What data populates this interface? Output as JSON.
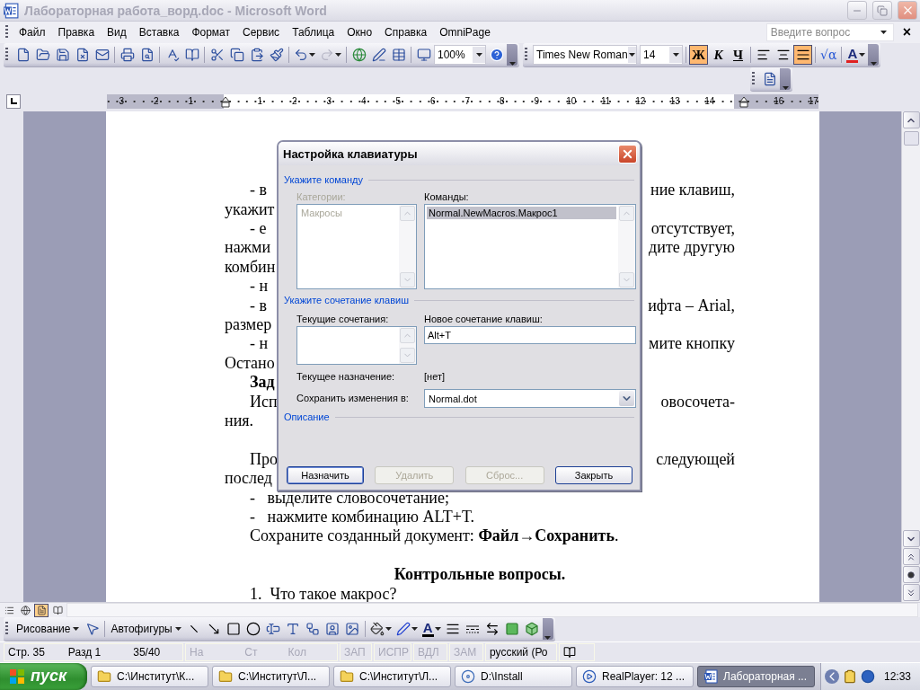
{
  "window": {
    "title": "Лабораторная работа_ворд.doc - Microsoft Word",
    "active": false
  },
  "menu": [
    "Файл",
    "Правка",
    "Вид",
    "Вставка",
    "Формат",
    "Сервис",
    "Таблица",
    "Окно",
    "Справка",
    "OmniPage"
  ],
  "help_field": {
    "placeholder": "Введите вопрос",
    "close": "×"
  },
  "standard_toolbar": {
    "zoom": "100%",
    "redo_disabled": true
  },
  "formatting_toolbar": {
    "font": "Times New Roman",
    "size": "14",
    "styles": [
      {
        "label": "Ж",
        "selected": true
      },
      {
        "label": "К",
        "selected": false
      },
      {
        "label": "Ч",
        "selected": false
      }
    ],
    "alignments": [
      {
        "selected": false
      },
      {
        "selected": false
      },
      {
        "selected": true
      }
    ],
    "equation": "√α",
    "font_color": "A"
  },
  "ruler": {
    "left_marks": [
      "3",
      "2",
      "1"
    ],
    "marks": [
      "1",
      "2",
      "3",
      "4",
      "5",
      "6",
      "7",
      "8",
      "9",
      "10",
      "11",
      "12",
      "13",
      "14"
    ],
    "end_marks": [
      "16",
      "17"
    ]
  },
  "document": {
    "rows": [
      {
        "kind": "line",
        "indent": true,
        "left": "- в",
        "right": "ние клавиш,",
        "gap_before": false
      },
      {
        "kind": "line",
        "indent": false,
        "left": "укажит",
        "gap_before": false
      },
      {
        "kind": "line",
        "indent": true,
        "left": "- е",
        "right": "отсутствует,",
        "gap_before": false
      },
      {
        "kind": "line",
        "indent": false,
        "left": "нажми",
        "right": "дите другую",
        "gap_before": false
      },
      {
        "kind": "line",
        "indent": false,
        "left": "комбин",
        "gap_before": false
      },
      {
        "kind": "line",
        "indent": true,
        "left": "- н",
        "gap_before": false
      },
      {
        "kind": "line",
        "indent": true,
        "left": "- в",
        "right": "ифта – Arial,",
        "gap_before": false
      },
      {
        "kind": "line",
        "indent": false,
        "left": "размер",
        "gap_before": false
      },
      {
        "kind": "line",
        "indent": true,
        "left": "- н",
        "right": "мите кнопку",
        "gap_before": false
      },
      {
        "kind": "line",
        "indent": false,
        "left": "Остано",
        "gap_before": false
      },
      {
        "kind": "bold",
        "indent": true,
        "left": "Зад",
        "gap_before": false
      },
      {
        "kind": "line",
        "indent": true,
        "left": "Исп",
        "right": "овосочета-",
        "gap_before": false
      },
      {
        "kind": "line",
        "indent": false,
        "left": "ния.",
        "gap_before": false
      },
      {
        "kind": "line",
        "indent": true,
        "left": "Про",
        "right": "следующей",
        "gap_before": true
      },
      {
        "kind": "line",
        "indent": false,
        "left": "послед",
        "gap_before": false
      },
      {
        "kind": "line",
        "indent": true,
        "left": "-   выделите словосочетание;",
        "gap_before": false
      },
      {
        "kind": "line",
        "indent": true,
        "left": "-   нажмите комбинацию ALT+T.",
        "gap_before": false
      },
      {
        "kind": "line",
        "indent": true,
        "left": "Сохраните созданный документ: **Файл→Сохранить**.",
        "gap_before": false
      },
      {
        "kind": "heading",
        "indent": false,
        "left": "Контрольные вопросы.",
        "gap_before": true
      },
      {
        "kind": "line",
        "indent": true,
        "left": "1.  Что такое макрос?",
        "gap_before": false
      }
    ]
  },
  "dialog": {
    "title": "Настройка клавиатуры",
    "command_group": "Укажите команду",
    "categories": {
      "label": "Категории:",
      "disabled": true,
      "items": [
        {
          "text": "Макросы",
          "selected": false
        }
      ]
    },
    "commands": {
      "label": "Команды:",
      "disabled": false,
      "items": [
        {
          "text": "Normal.NewMacros.Макрос1",
          "selected": true
        }
      ]
    },
    "keys_group": "Укажите сочетание клавиш",
    "current_keys": {
      "label": "Текущие сочетания:"
    },
    "new_keys": {
      "label": "Новое сочетание клавиш:",
      "value": "Alt+T"
    },
    "assignment": {
      "label": "Текущее назначение:",
      "value": "[нет]"
    },
    "save_in": {
      "label": "Сохранить изменения в:",
      "value": "Normal.dot"
    },
    "description_group": "Описание",
    "buttons": [
      {
        "label": "Назначить",
        "default": true,
        "disabled": false
      },
      {
        "label": "Удалить",
        "default": false,
        "disabled": true
      },
      {
        "label": "Сброс...",
        "default": false,
        "disabled": true
      },
      {
        "label": "Закрыть",
        "default": false,
        "disabled": false
      }
    ]
  },
  "drawing_toolbar": {
    "draw_menu": "Рисование",
    "autoshapes": "Автофигуры",
    "font_color": "A"
  },
  "status_bar": {
    "panels": [
      {
        "items": [
          {
            "text": "Стр. 35",
            "disabled": false
          },
          {
            "text": "Разд 1",
            "disabled": false
          },
          {
            "text": "35/40",
            "disabled": false
          }
        ]
      },
      {
        "items": [
          {
            "text": "На",
            "disabled": true
          },
          {
            "text": "Ст",
            "disabled": true
          },
          {
            "text": "Кол",
            "disabled": true
          }
        ]
      },
      {
        "items": [
          {
            "text": "ЗАП",
            "disabled": true
          }
        ]
      },
      {
        "items": [
          {
            "text": "ИСПР",
            "disabled": true
          }
        ]
      },
      {
        "items": [
          {
            "text": "ВДЛ",
            "disabled": true
          }
        ]
      },
      {
        "items": [
          {
            "text": "ЗАМ",
            "disabled": true
          }
        ]
      },
      {
        "items": [
          {
            "text": "русский (Ро",
            "disabled": false
          }
        ]
      }
    ]
  },
  "taskbar": {
    "start": "пуск",
    "tasks": [
      {
        "kind": "folder",
        "label": "C:\\Институт\\К...",
        "selected": false
      },
      {
        "kind": "folder",
        "label": "C:\\Институт\\Л...",
        "selected": false
      },
      {
        "kind": "folder",
        "label": "C:\\Институт\\Л...",
        "selected": false
      },
      {
        "kind": "installer",
        "label": "D:\\Install",
        "selected": false
      },
      {
        "kind": "player",
        "label": "RealPlayer: 12  ...",
        "selected": false
      },
      {
        "kind": "word",
        "label": "Лабораторная ...",
        "selected": true
      }
    ],
    "clock": "12:33"
  }
}
